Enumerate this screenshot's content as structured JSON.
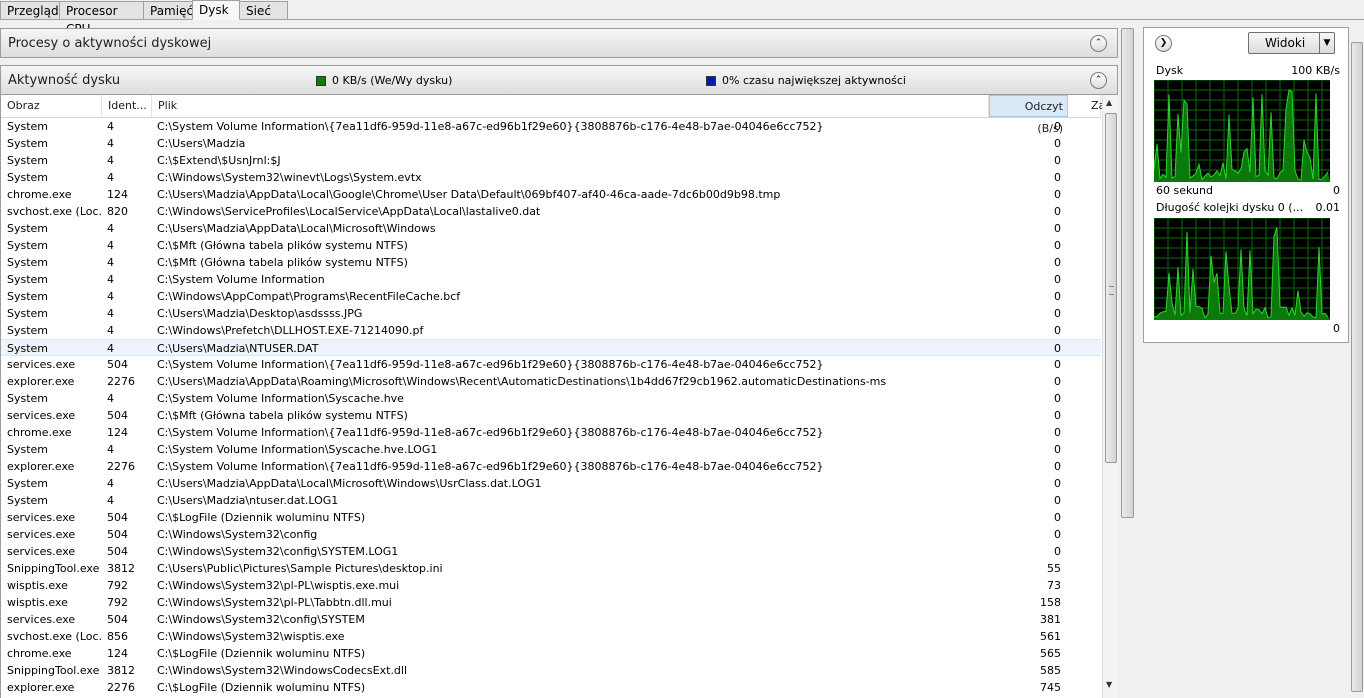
{
  "tabs": [
    {
      "label": "Przegląd"
    },
    {
      "label": "Procesor CPU"
    },
    {
      "label": "Pamięć"
    },
    {
      "label": "Dysk"
    },
    {
      "label": "Sieć"
    }
  ],
  "sections": {
    "processes_title": "Procesy o aktywności dyskowej",
    "activity_title": "Aktywność dysku",
    "legend_io": "0 KB/s (We/Wy dysku)",
    "legend_active": "0% czasu największej aktywności",
    "legend_io_color": "#0e7a0e",
    "legend_active_color": "#0a1aa8"
  },
  "table": {
    "columns": {
      "image": "Obraz",
      "pid": "Ident...",
      "file": "Plik",
      "read": "Odczyt (B/s)",
      "write": "Za"
    },
    "rows": [
      {
        "image": "System",
        "pid": "4",
        "file": "C:\\System Volume Information\\{7ea11df6-959d-11e8-a67c-ed96b1f29e60}{3808876b-c176-4e48-b7ae-04046e6cc752}",
        "read": "0"
      },
      {
        "image": "System",
        "pid": "4",
        "file": "C:\\Users\\Madzia",
        "read": "0"
      },
      {
        "image": "System",
        "pid": "4",
        "file": "C:\\$Extend\\$UsnJrnl:$J",
        "read": "0"
      },
      {
        "image": "System",
        "pid": "4",
        "file": "C:\\Windows\\System32\\winevt\\Logs\\System.evtx",
        "read": "0"
      },
      {
        "image": "chrome.exe",
        "pid": "124",
        "file": "C:\\Users\\Madzia\\AppData\\Local\\Google\\Chrome\\User Data\\Default\\069bf407-af40-46ca-aade-7dc6b00d9b98.tmp",
        "read": "0"
      },
      {
        "image": "svchost.exe (Loc...",
        "pid": "820",
        "file": "C:\\Windows\\ServiceProfiles\\LocalService\\AppData\\Local\\lastalive0.dat",
        "read": "0"
      },
      {
        "image": "System",
        "pid": "4",
        "file": "C:\\Users\\Madzia\\AppData\\Local\\Microsoft\\Windows",
        "read": "0"
      },
      {
        "image": "System",
        "pid": "4",
        "file": "C:\\$Mft (Główna tabela plików systemu NTFS)",
        "read": "0"
      },
      {
        "image": "System",
        "pid": "4",
        "file": "C:\\$Mft (Główna tabela plików systemu NTFS)",
        "read": "0"
      },
      {
        "image": "System",
        "pid": "4",
        "file": "C:\\System Volume Information",
        "read": "0"
      },
      {
        "image": "System",
        "pid": "4",
        "file": "C:\\Windows\\AppCompat\\Programs\\RecentFileCache.bcf",
        "read": "0"
      },
      {
        "image": "System",
        "pid": "4",
        "file": "C:\\Users\\Madzia\\Desktop\\asdssss.JPG",
        "read": "0"
      },
      {
        "image": "System",
        "pid": "4",
        "file": "C:\\Windows\\Prefetch\\DLLHOST.EXE-71214090.pf",
        "read": "0"
      },
      {
        "image": "System",
        "pid": "4",
        "file": "C:\\Users\\Madzia\\NTUSER.DAT",
        "read": "0",
        "selected": true
      },
      {
        "image": "services.exe",
        "pid": "504",
        "file": "C:\\System Volume Information\\{7ea11df6-959d-11e8-a67c-ed96b1f29e60}{3808876b-c176-4e48-b7ae-04046e6cc752}",
        "read": "0"
      },
      {
        "image": "explorer.exe",
        "pid": "2276",
        "file": "C:\\Users\\Madzia\\AppData\\Roaming\\Microsoft\\Windows\\Recent\\AutomaticDestinations\\1b4dd67f29cb1962.automaticDestinations-ms",
        "read": "0"
      },
      {
        "image": "System",
        "pid": "4",
        "file": "C:\\System Volume Information\\Syscache.hve",
        "read": "0"
      },
      {
        "image": "services.exe",
        "pid": "504",
        "file": "C:\\$Mft (Główna tabela plików systemu NTFS)",
        "read": "0"
      },
      {
        "image": "chrome.exe",
        "pid": "124",
        "file": "C:\\System Volume Information\\{7ea11df6-959d-11e8-a67c-ed96b1f29e60}{3808876b-c176-4e48-b7ae-04046e6cc752}",
        "read": "0"
      },
      {
        "image": "System",
        "pid": "4",
        "file": "C:\\System Volume Information\\Syscache.hve.LOG1",
        "read": "0"
      },
      {
        "image": "explorer.exe",
        "pid": "2276",
        "file": "C:\\System Volume Information\\{7ea11df6-959d-11e8-a67c-ed96b1f29e60}{3808876b-c176-4e48-b7ae-04046e6cc752}",
        "read": "0"
      },
      {
        "image": "System",
        "pid": "4",
        "file": "C:\\Users\\Madzia\\AppData\\Local\\Microsoft\\Windows\\UsrClass.dat.LOG1",
        "read": "0"
      },
      {
        "image": "System",
        "pid": "4",
        "file": "C:\\Users\\Madzia\\ntuser.dat.LOG1",
        "read": "0"
      },
      {
        "image": "services.exe",
        "pid": "504",
        "file": "C:\\$LogFile (Dziennik woluminu NTFS)",
        "read": "0"
      },
      {
        "image": "services.exe",
        "pid": "504",
        "file": "C:\\Windows\\System32\\config",
        "read": "0"
      },
      {
        "image": "services.exe",
        "pid": "504",
        "file": "C:\\Windows\\System32\\config\\SYSTEM.LOG1",
        "read": "0"
      },
      {
        "image": "SnippingTool.exe",
        "pid": "3812",
        "file": "C:\\Users\\Public\\Pictures\\Sample Pictures\\desktop.ini",
        "read": "55"
      },
      {
        "image": "wisptis.exe",
        "pid": "792",
        "file": "C:\\Windows\\System32\\pl-PL\\wisptis.exe.mui",
        "read": "73"
      },
      {
        "image": "wisptis.exe",
        "pid": "792",
        "file": "C:\\Windows\\System32\\pl-PL\\Tabbtn.dll.mui",
        "read": "158"
      },
      {
        "image": "services.exe",
        "pid": "504",
        "file": "C:\\Windows\\System32\\config\\SYSTEM",
        "read": "381"
      },
      {
        "image": "svchost.exe (Loc...",
        "pid": "856",
        "file": "C:\\Windows\\System32\\wisptis.exe",
        "read": "561"
      },
      {
        "image": "chrome.exe",
        "pid": "124",
        "file": "C:\\$LogFile (Dziennik woluminu NTFS)",
        "read": "565"
      },
      {
        "image": "SnippingTool.exe",
        "pid": "3812",
        "file": "C:\\Windows\\System32\\WindowsCodecsExt.dll",
        "read": "585"
      },
      {
        "image": "explorer.exe",
        "pid": "2276",
        "file": "C:\\$LogFile (Dziennik woluminu NTFS)",
        "read": "745"
      }
    ]
  },
  "side": {
    "views_label": "Widoki",
    "disk_label": "Dysk",
    "disk_max": "100 KB/s",
    "time_label": "60 sekund",
    "time_min": "0",
    "queue_label": "Długość kolejki dysku 0 (...",
    "queue_max": "0.01",
    "queue_min": "0",
    "graph_line_color": "#2bd62b",
    "graph_fill_color": "#0b7a0b",
    "graph_grid_color": "#0b6e0b"
  }
}
